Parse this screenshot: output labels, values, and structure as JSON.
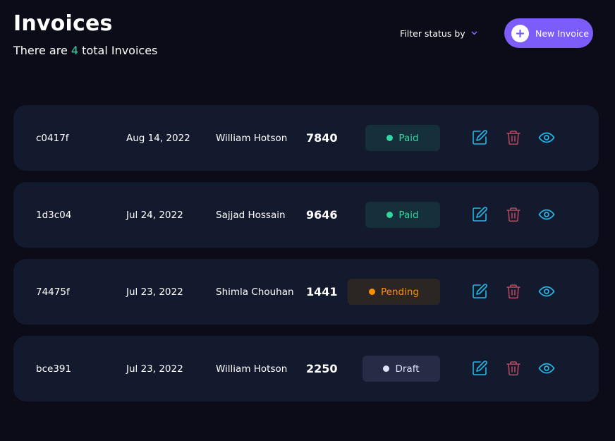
{
  "header": {
    "title": "Invoices",
    "subtitle_prefix": "There are",
    "count": "4",
    "subtitle_suffix": "total Invoices"
  },
  "filter": {
    "label": "Filter status by",
    "icon": "chevron-down-icon"
  },
  "new_invoice": {
    "label": "New Invoice",
    "icon": "plus-icon"
  },
  "colors": {
    "accent": "#7c5dfa",
    "paid": "#33d69f",
    "pending": "#ff8f00",
    "draft": "#dfe3fa",
    "edit_icon": "#22b8e8",
    "delete_icon": "#b8475e",
    "view_icon": "#22b8e8"
  },
  "invoices": [
    {
      "id": "c0417f",
      "date": "Aug 14, 2022",
      "name": "William Hotson",
      "amount": "7840",
      "status": "Paid",
      "status_kind": "paid"
    },
    {
      "id": "1d3c04",
      "date": "Jul 24, 2022",
      "name": "Sajjad Hossain",
      "amount": "9646",
      "status": "Paid",
      "status_kind": "paid"
    },
    {
      "id": "74475f",
      "date": "Jul 23, 2022",
      "name": "Shimla Chouhan",
      "amount": "1441",
      "status": "Pending",
      "status_kind": "pending"
    },
    {
      "id": "bce391",
      "date": "Jul 23, 2022",
      "name": "William Hotson",
      "amount": "2250",
      "status": "Draft",
      "status_kind": "draft"
    }
  ],
  "row_icons": [
    "edit-icon",
    "trash-icon",
    "eye-icon"
  ]
}
